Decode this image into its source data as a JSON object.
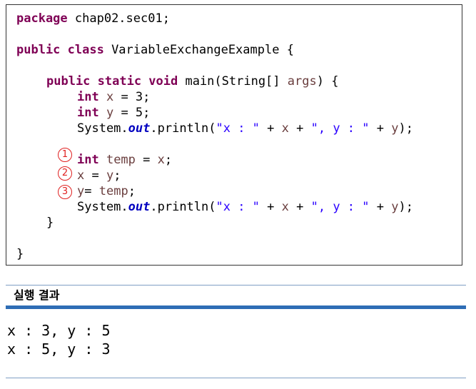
{
  "code": {
    "package_kw": "package",
    "package_name": " chap02.sec01;",
    "class_kw": "public class",
    "class_decl": " VariableExchangeExample {",
    "main_kw": "public static void",
    "main_sig_a": " main(String[] ",
    "main_args": "args",
    "main_sig_b": ") {",
    "int_kw": "int",
    "x_decl_var": " x",
    "x_decl_val": " = 3;",
    "y_decl_var": " y",
    "y_decl_val": " = 5;",
    "sys_prefix": "System.",
    "out_field": "out",
    "println_open": ".println(",
    "str_x": "\"x : \"",
    "plus": " + ",
    "var_x": "x",
    "str_y": "\", y : \"",
    "var_y": "y",
    "close": ");",
    "temp_var": " temp",
    "temp_assign": " = ",
    "semi": ";",
    "eq": " = ",
    "y_assign": "= ",
    "temp_ref": "temp",
    "brace_close_method": "}",
    "brace_close_class": "}"
  },
  "markers": {
    "m1": "1",
    "m2": "2",
    "m3": "3"
  },
  "result": {
    "title": "실행 결과",
    "line1": "x : 3, y : 5",
    "line2": "x : 5, y : 3"
  },
  "colors": {
    "keyword": "#7f0055",
    "variable": "#6a3e3e",
    "string": "#2a00ff",
    "field": "#0000c0",
    "marker": "#e02020",
    "rule_accent": "#2e6db5"
  }
}
